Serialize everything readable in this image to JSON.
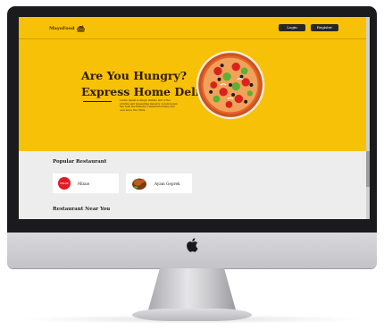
{
  "navbar": {
    "brand": "MayoFood",
    "brand_icon": "burger-icon",
    "login_label": "Login",
    "register_label": "Register"
  },
  "hero": {
    "title_line1": "Are You Hungry?",
    "title_line2": "Express Home Delivery",
    "description": "Lorem Ipsum is simply dummy text of the printing and typesetting industry. Lorem Ipsum has been the industry's standard dummy text ever since the 1500s.",
    "image": "pizza-image"
  },
  "popular": {
    "title": "Popular Restaurant",
    "restaurants": [
      {
        "name": "Mixue",
        "logo_text": "MIXUE"
      },
      {
        "name": "Ayam Geprek"
      }
    ]
  },
  "near": {
    "title": "Restaurant Near You"
  },
  "colors": {
    "hero_bg": "#f6c107",
    "button_bg": "#262626",
    "section_bg": "#ededed"
  }
}
